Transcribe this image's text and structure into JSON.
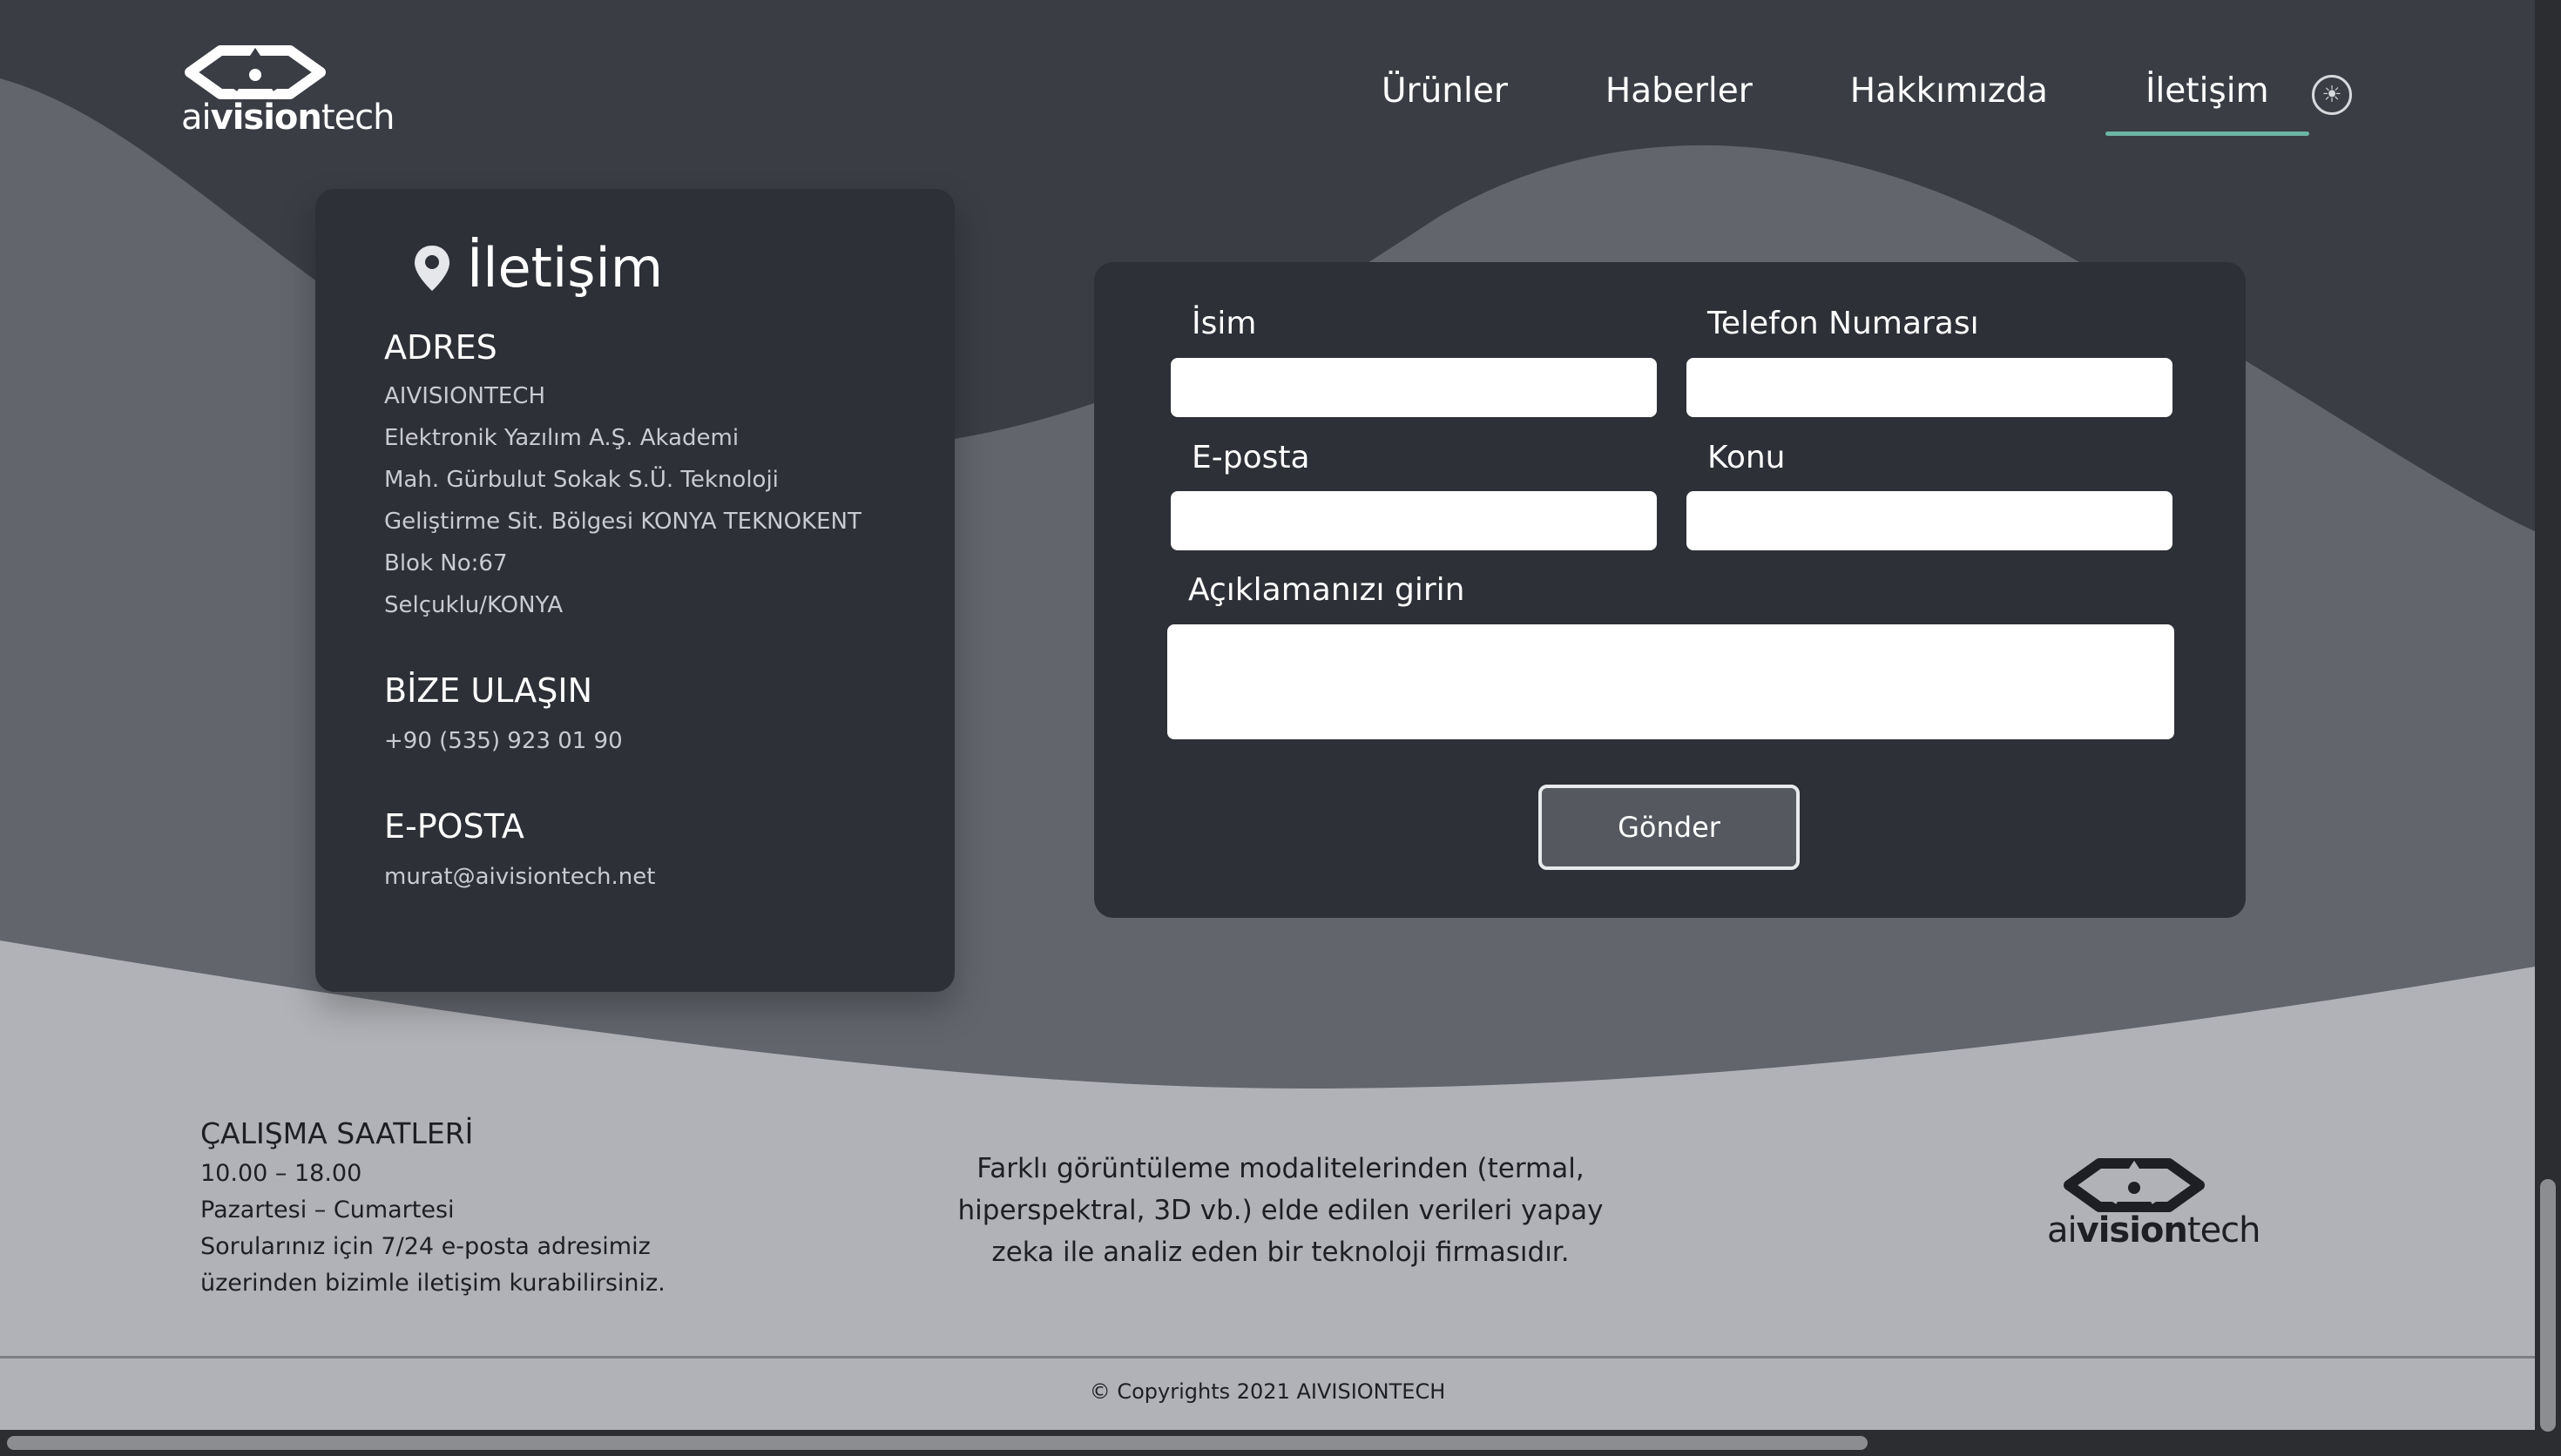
{
  "brand": {
    "prefix": "ai",
    "bold": "vision",
    "suffix": "tech"
  },
  "nav": {
    "items": [
      {
        "label": "Ürünler"
      },
      {
        "label": "Haberler"
      },
      {
        "label": "Hakkımızda"
      },
      {
        "label": "İletişim",
        "active": true
      }
    ],
    "theme_icon": "sun-icon"
  },
  "contact": {
    "title": "İletişim",
    "title_icon": "location-pin-icon",
    "address_heading": "ADRES",
    "address_lines": [
      "AIVISIONTECH",
      "Elektronik Yazılım A.Ş. Akademi",
      "Mah. Gürbulut Sokak S.Ü. Teknoloji",
      "Geliştirme Sit. Bölgesi KONYA TEKNOKENT",
      "Blok No:67",
      "Selçuklu/KONYA"
    ],
    "reach_heading": "BİZE ULAŞIN",
    "phone": "+90 (535) 923 01 90",
    "email_heading": "E-POSTA",
    "email": "murat@aivisiontech.net"
  },
  "form": {
    "name_label": "İsim",
    "phone_label": "Telefon Numarası",
    "email_label": "E-posta",
    "subject_label": "Konu",
    "message_label": "Açıklamanızı girin",
    "submit_label": "Gönder"
  },
  "footer": {
    "hours_heading": "ÇALIŞMA SAATLERİ",
    "hours": "10.00 – 18.00",
    "days": "Pazartesi – Cumartesi",
    "note_line1": "Sorularınız için 7/24 e-posta adresimiz",
    "note_line2": "üzerinden bizimle iletişim kurabilirsiniz.",
    "about_line1": "Farklı görüntüleme modalitelerinden (termal,",
    "about_line2": "hiperspektral, 3D vb.) elde edilen verileri yapay",
    "about_line3": "zeka ile analiz eden bir teknoloji firmasıdır.",
    "copyright": "© Copyrights 2021 AIVISIONTECH"
  },
  "colors": {
    "bg_dark": "#3a3d44",
    "wave_mid": "#62656c",
    "wave_light": "#b1b2b7",
    "card": "#2e3037",
    "accent": "#6bb5a3"
  }
}
